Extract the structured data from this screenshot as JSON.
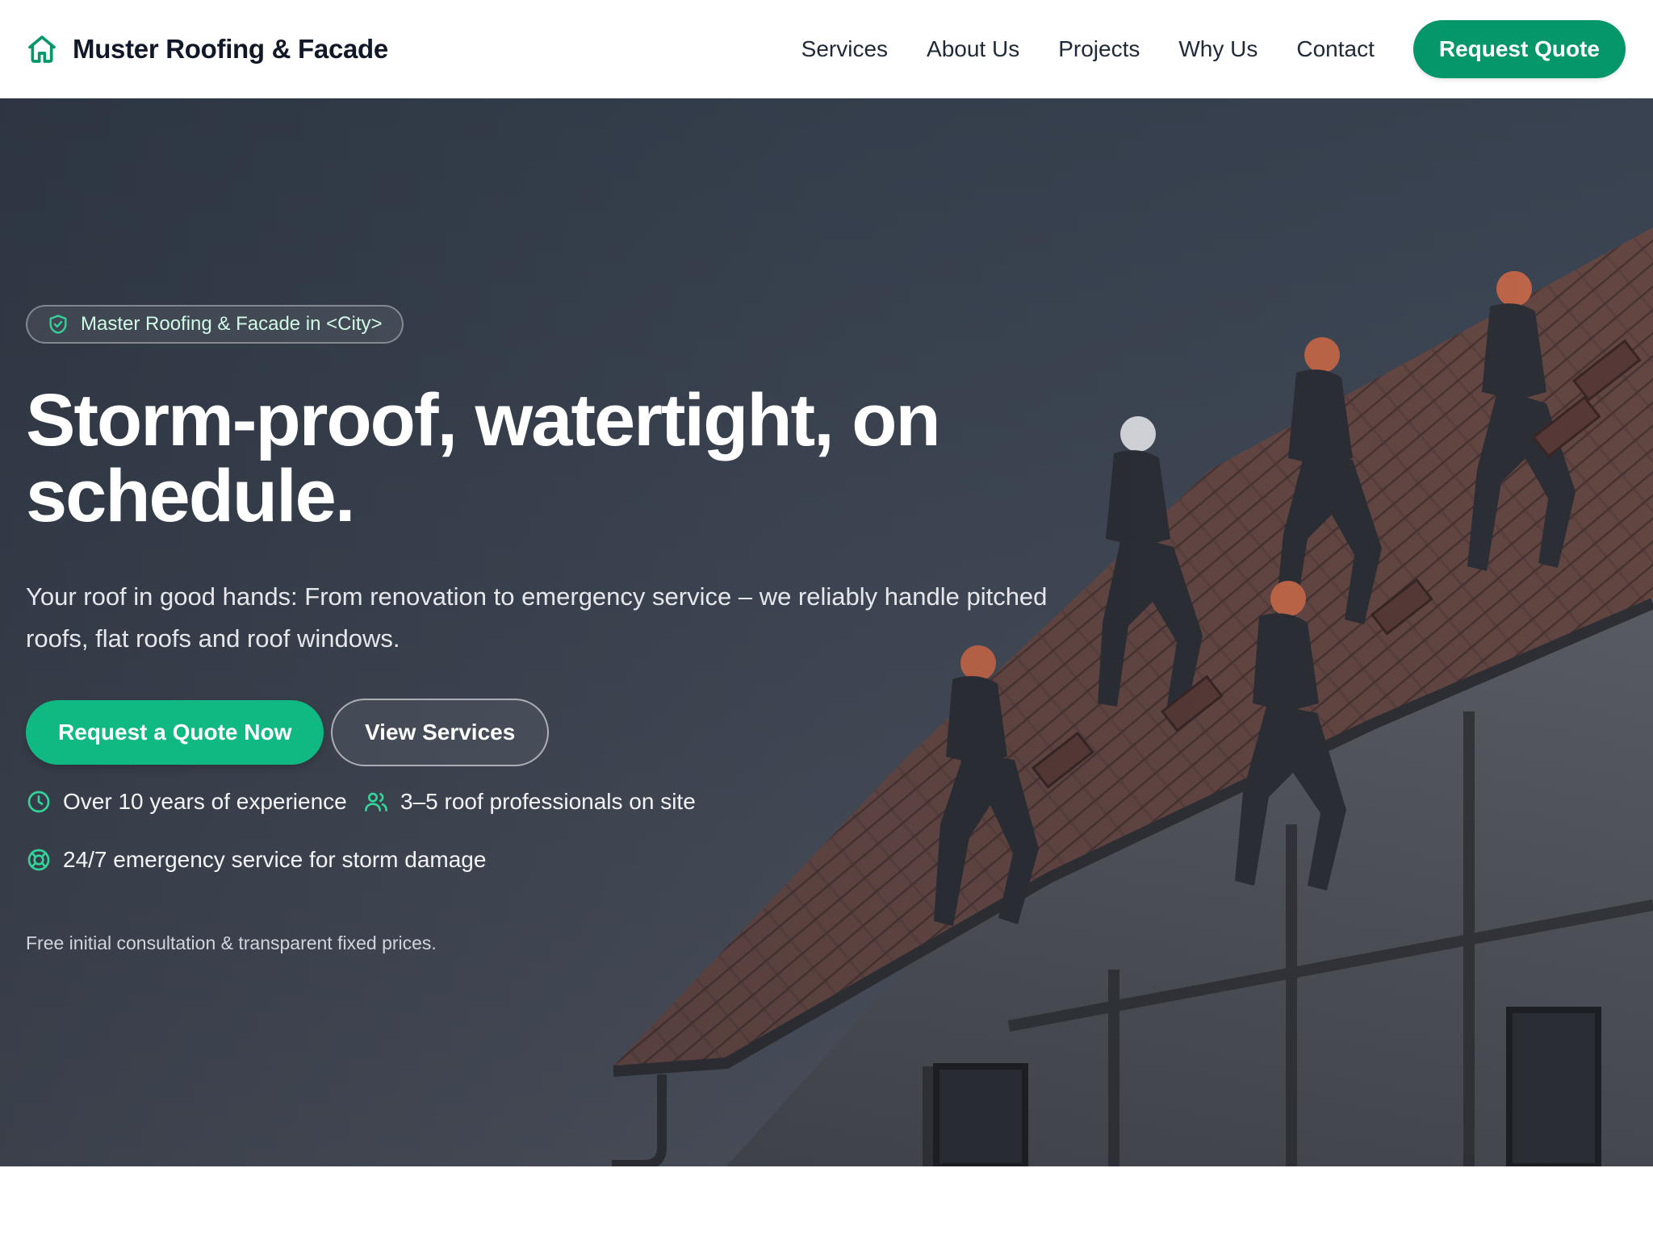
{
  "header": {
    "brand_name": "Muster Roofing & Facade",
    "nav": [
      "Services",
      "About Us",
      "Projects",
      "Why Us",
      "Contact"
    ],
    "cta_label": "Request Quote"
  },
  "hero": {
    "badge": "Master Roofing & Facade in <City>",
    "headline": "Storm-proof, watertight, on schedule.",
    "subline": "Your roof in good hands: From renovation to emergency service – we reliably handle pitched roofs, flat roofs and roof windows.",
    "primary_button": "Request a Quote Now",
    "secondary_button": "View Services",
    "features": [
      {
        "icon": "clock-icon",
        "text": "Over 10 years of experience"
      },
      {
        "icon": "users-icon",
        "text": "3–5 roof professionals on site"
      },
      {
        "icon": "lifebuoy-icon",
        "text": "24/7 emergency service for storm damage"
      }
    ],
    "note": "Free initial consultation & transparent fixed prices."
  },
  "colors": {
    "accent": "#059669",
    "accent_bright": "#10b981",
    "hero_overlay": "#3a4452"
  }
}
